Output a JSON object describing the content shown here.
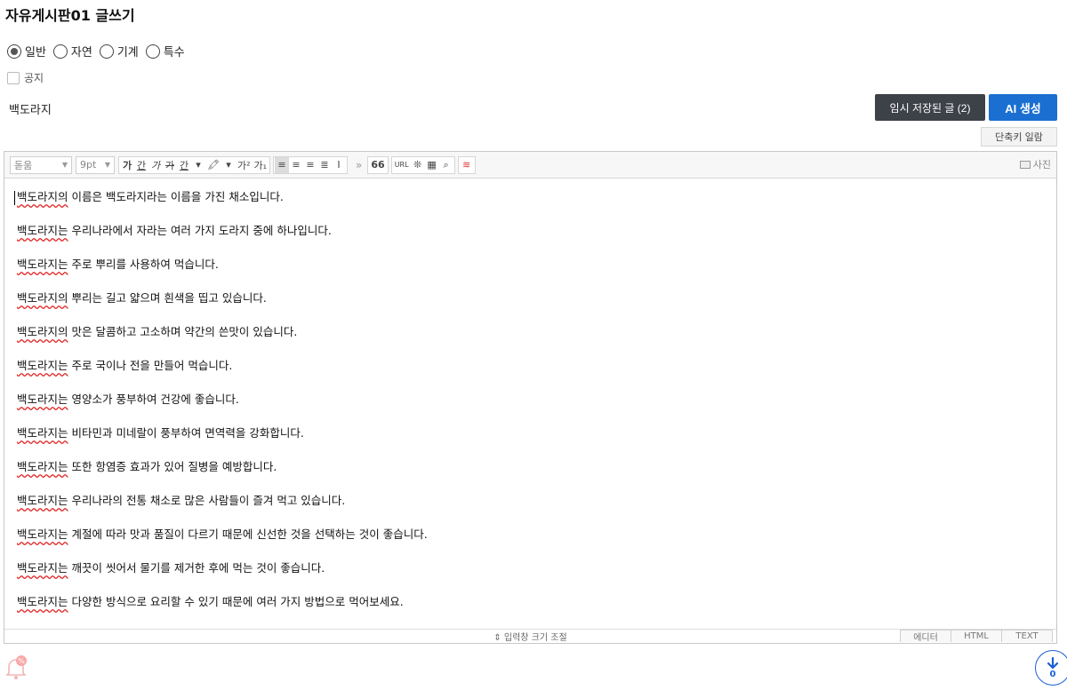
{
  "page": {
    "title": "자유게시판01 글쓰기"
  },
  "categories": [
    {
      "label": "일반",
      "checked": true
    },
    {
      "label": "자연",
      "checked": false
    },
    {
      "label": "기계",
      "checked": false
    },
    {
      "label": "특수",
      "checked": false
    }
  ],
  "notice_label": "공지",
  "post_title": "백도라지",
  "buttons": {
    "temp_saved": "임시 저장된 글 (2)",
    "ai_generate": "AI 생성",
    "shortcuts": "단축키 일람"
  },
  "toolbar": {
    "font_family": "돋움",
    "font_size": "9pt",
    "more": "»",
    "quote": "66",
    "url": "URL",
    "photo": "사진",
    "format_buttons": [
      "가",
      "간",
      "가",
      "가",
      "간"
    ],
    "sup": "가²",
    "sub": "가₁"
  },
  "content_lines": [
    "백도라지의 이름은 백도라지라는 이름을 가진 채소입니다.",
    "백도라지는 우리나라에서 자라는 여러 가지 도라지 중에 하나입니다.",
    "백도라지는 주로 뿌리를 사용하여 먹습니다.",
    "백도라지의 뿌리는 길고 얇으며 흰색을 띱고 있습니다.",
    "백도라지의 맛은 달콤하고 고소하며 약간의 쓴맛이 있습니다.",
    "백도라지는 주로 국이나 전을 만들어 먹습니다.",
    "백도라지는 영양소가 풍부하여 건강에 좋습니다.",
    "백도라지는 비타민과 미네랄이 풍부하여 면역력을 강화합니다.",
    "백도라지는 또한 항염증 효과가 있어 질병을 예방합니다.",
    "백도라지는 우리나라의 전통 채소로 많은 사람들이 즐겨 먹고 있습니다.",
    "백도라지는 계절에 따라 맛과 품질이 다르기 때문에 신선한 것을 선택하는 것이 좋습니다.",
    "백도라지는 깨끗이 씻어서 물기를 제거한 후에 먹는 것이 좋습니다.",
    "백도라지는 다양한 방식으로 요리할 수 있기 때문에 여러 가지 방법으로 먹어보세요."
  ],
  "resize_label": "⇕ 입력창 크기 조절",
  "modes": [
    "에디터",
    "HTML",
    "TEXT"
  ],
  "scroll_count": "0",
  "colors": {
    "ai_button": "#1a6fd1",
    "temp_button": "#3d4148",
    "spellcheck": "#e02020"
  }
}
